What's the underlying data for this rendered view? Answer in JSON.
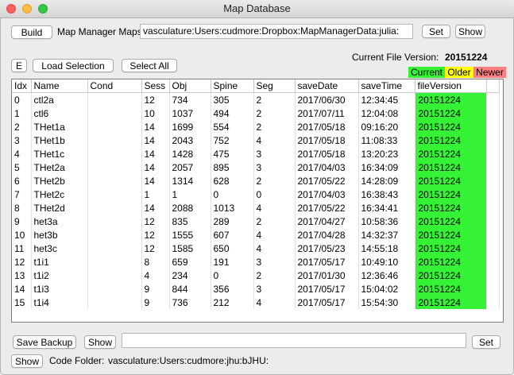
{
  "window": {
    "title": "Map Database"
  },
  "toolbar": {
    "build_label": "Build",
    "maps_label": "Map Manager Maps",
    "maps_path": "vasculature:Users:cudmore:Dropbox:MapManagerData:julia:",
    "set_label": "Set",
    "show_label": "Show"
  },
  "actions": {
    "e_label": "E",
    "load_selection_label": "Load Selection",
    "select_all_label": "Select All",
    "file_version_label": "Current File Version:",
    "file_version_value": "20151224"
  },
  "legend": {
    "current": {
      "label": "Current",
      "color": "#36f236"
    },
    "older": {
      "label": "Older",
      "color": "#ffff00"
    },
    "newer": {
      "label": "Newer",
      "color": "#ff8080"
    }
  },
  "table": {
    "columns": [
      "Idx",
      "Name",
      "Cond",
      "Sess",
      "Obj",
      "Spine",
      "Seg",
      "saveDate",
      "saveTime",
      "fileVersion"
    ],
    "rows": [
      [
        "0",
        "ctl2a",
        "",
        "12",
        "734",
        "305",
        "2",
        "2017/06/30",
        "12:34:45",
        "20151224"
      ],
      [
        "1",
        "ctl6",
        "",
        "10",
        "1037",
        "494",
        "2",
        "2017/07/11",
        "12:04:08",
        "20151224"
      ],
      [
        "2",
        "THet1a",
        "",
        "14",
        "1699",
        "554",
        "2",
        "2017/05/18",
        "09:16:20",
        "20151224"
      ],
      [
        "3",
        "THet1b",
        "",
        "14",
        "2043",
        "752",
        "4",
        "2017/05/18",
        "11:08:33",
        "20151224"
      ],
      [
        "4",
        "THet1c",
        "",
        "14",
        "1428",
        "475",
        "3",
        "2017/05/18",
        "13:20:23",
        "20151224"
      ],
      [
        "5",
        "THet2a",
        "",
        "14",
        "2057",
        "895",
        "3",
        "2017/04/03",
        "16:34:09",
        "20151224"
      ],
      [
        "6",
        "THet2b",
        "",
        "14",
        "1314",
        "628",
        "2",
        "2017/05/22",
        "14:28:09",
        "20151224"
      ],
      [
        "7",
        "THet2c",
        "",
        "1",
        "1",
        "0",
        "0",
        "2017/04/03",
        "16:38:43",
        "20151224"
      ],
      [
        "8",
        "THet2d",
        "",
        "14",
        "2088",
        "1013",
        "4",
        "2017/05/22",
        "16:34:41",
        "20151224"
      ],
      [
        "9",
        "het3a",
        "",
        "12",
        "835",
        "289",
        "2",
        "2017/04/27",
        "10:58:36",
        "20151224"
      ],
      [
        "10",
        "het3b",
        "",
        "12",
        "1555",
        "607",
        "4",
        "2017/04/28",
        "14:32:37",
        "20151224"
      ],
      [
        "11",
        "het3c",
        "",
        "12",
        "1585",
        "650",
        "4",
        "2017/05/23",
        "14:55:18",
        "20151224"
      ],
      [
        "12",
        "t1i1",
        "",
        "8",
        "659",
        "191",
        "3",
        "2017/05/17",
        "10:49:10",
        "20151224"
      ],
      [
        "13",
        "t1i2",
        "",
        "4",
        "234",
        "0",
        "2",
        "2017/01/30",
        "12:36:46",
        "20151224"
      ],
      [
        "14",
        "t1i3",
        "",
        "9",
        "844",
        "356",
        "3",
        "2017/05/17",
        "15:04:02",
        "20151224"
      ],
      [
        "15",
        "t1i4",
        "",
        "9",
        "736",
        "212",
        "4",
        "2017/05/17",
        "15:54:30",
        "20151224"
      ]
    ]
  },
  "footer": {
    "save_backup_label": "Save Backup",
    "show_label": "Show",
    "backup_path": "",
    "set_label": "Set",
    "show2_label": "Show",
    "code_folder_label": "Code Folder:",
    "code_folder_value": "vasculature:Users:cudmore:jhu:bJHU:"
  }
}
